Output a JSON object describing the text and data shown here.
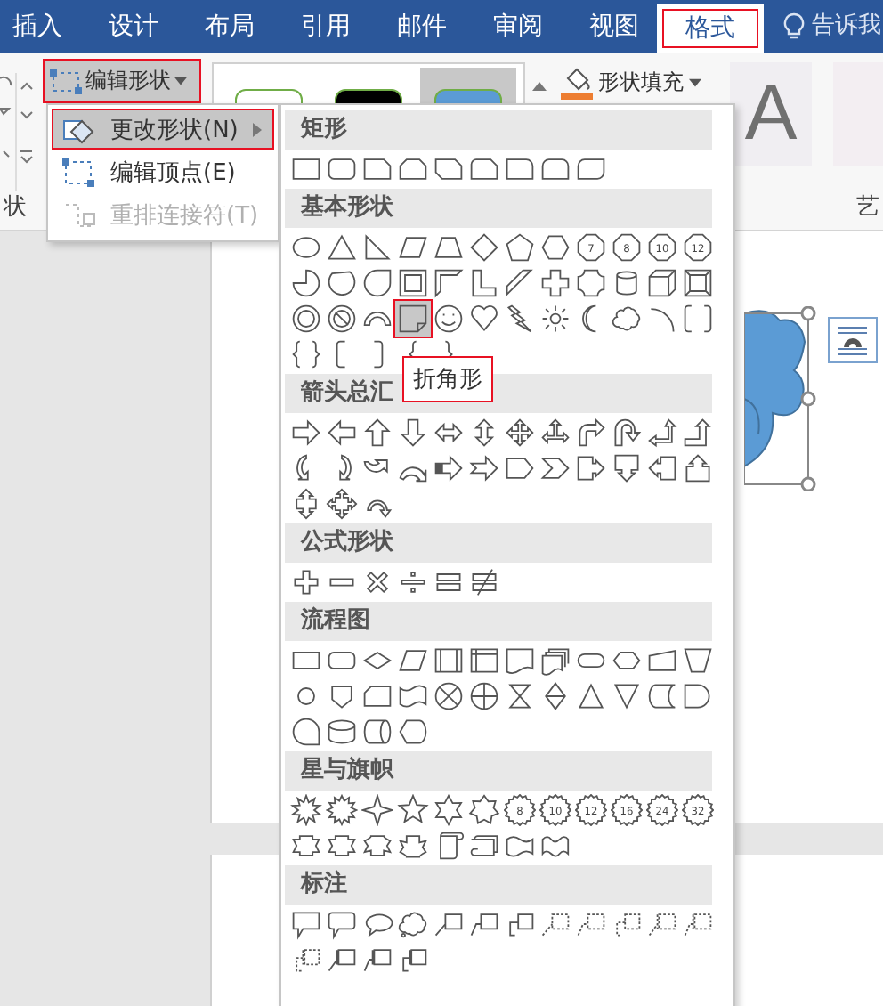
{
  "tabs": [
    {
      "label": "插入",
      "selected": false
    },
    {
      "label": "设计",
      "selected": false
    },
    {
      "label": "布局",
      "selected": false
    },
    {
      "label": "引用",
      "selected": false
    },
    {
      "label": "邮件",
      "selected": false
    },
    {
      "label": "审阅",
      "selected": false
    },
    {
      "label": "视图",
      "selected": false
    },
    {
      "label": "格式",
      "selected": true
    }
  ],
  "tell_me": "告诉我",
  "ribbon": {
    "edit_shape_button": {
      "label": "编辑形状",
      "highlighted": true
    },
    "style_swatches": [
      {
        "color": "#ffffff",
        "selected": false
      },
      {
        "color": "#000000",
        "selected": false
      },
      {
        "color": "#5b9bd5",
        "selected": true
      }
    ],
    "shape_fill": "形状填充",
    "wordart": [
      "A"
    ],
    "group_labels": [
      "状",
      "艺"
    ]
  },
  "submenu": [
    {
      "label": "更改形状(N)",
      "selected": true,
      "disabled": false,
      "has_submenu": true
    },
    {
      "label": "编辑顶点(E)",
      "selected": false,
      "disabled": false,
      "has_submenu": false
    },
    {
      "label": "重排连接符(T)",
      "selected": false,
      "disabled": true,
      "has_submenu": false
    }
  ],
  "gallery": [
    {
      "title": "矩形",
      "shapes": [
        {
          "kind": "rectangle",
          "selected": false
        },
        {
          "kind": "rounded-rectangle",
          "selected": false
        },
        {
          "kind": "snipped-corner-rectangle",
          "selected": false
        },
        {
          "kind": "snipped-same-side-rectangle",
          "selected": false
        },
        {
          "kind": "snipped-diagonal-rectangle",
          "selected": false
        },
        {
          "kind": "snipped-rounded-rectangle",
          "selected": false
        },
        {
          "kind": "round-corner-rectangle",
          "selected": false
        },
        {
          "kind": "round-same-side-rectangle",
          "selected": false
        },
        {
          "kind": "round-diagonal-rectangle",
          "selected": false
        }
      ]
    },
    {
      "title": "基本形状",
      "shapes": [
        {
          "kind": "oval",
          "selected": false
        },
        {
          "kind": "triangle",
          "selected": false
        },
        {
          "kind": "right-triangle",
          "selected": false
        },
        {
          "kind": "parallelogram",
          "selected": false
        },
        {
          "kind": "trapezoid",
          "selected": false
        },
        {
          "kind": "diamond",
          "selected": false
        },
        {
          "kind": "pentagon",
          "selected": false
        },
        {
          "kind": "hexagon",
          "selected": false
        },
        {
          "kind": "polygon-badge",
          "label": "7",
          "selected": false
        },
        {
          "kind": "polygon-badge",
          "label": "8",
          "selected": false
        },
        {
          "kind": "polygon-badge",
          "label": "10",
          "selected": false
        },
        {
          "kind": "polygon-badge",
          "label": "12",
          "selected": false
        },
        {
          "kind": "pie",
          "selected": false
        },
        {
          "kind": "chord",
          "selected": false
        },
        {
          "kind": "teardrop",
          "selected": false
        },
        {
          "kind": "frame",
          "selected": false
        },
        {
          "kind": "half-frame",
          "selected": false
        },
        {
          "kind": "l-shape",
          "selected": false
        },
        {
          "kind": "diagonal-stripe",
          "selected": false
        },
        {
          "kind": "cross",
          "selected": false
        },
        {
          "kind": "plaque",
          "selected": false
        },
        {
          "kind": "can",
          "selected": false
        },
        {
          "kind": "cube",
          "selected": false
        },
        {
          "kind": "bevel",
          "selected": false
        },
        {
          "kind": "donut",
          "selected": false
        },
        {
          "kind": "no-symbol",
          "selected": false
        },
        {
          "kind": "block-arc",
          "selected": false
        },
        {
          "kind": "folded-corner",
          "selected": true
        },
        {
          "kind": "smiley",
          "selected": false
        },
        {
          "kind": "heart",
          "selected": false
        },
        {
          "kind": "lightning",
          "selected": false
        },
        {
          "kind": "sun",
          "selected": false
        },
        {
          "kind": "moon",
          "selected": false
        },
        {
          "kind": "cloud",
          "selected": false
        },
        {
          "kind": "arc",
          "selected": false
        },
        {
          "kind": "bracket-pair",
          "selected": false
        },
        {
          "kind": "brace-pair",
          "selected": false
        },
        {
          "kind": "left-bracket",
          "selected": false
        },
        {
          "kind": "right-bracket",
          "selected": false
        },
        {
          "kind": "left-brace",
          "selected": false
        },
        {
          "kind": "right-brace",
          "selected": false
        }
      ]
    },
    {
      "title": "箭头总汇",
      "shapes": [
        {
          "kind": "right-arrow",
          "selected": false
        },
        {
          "kind": "left-arrow",
          "selected": false
        },
        {
          "kind": "up-arrow",
          "selected": false
        },
        {
          "kind": "down-arrow",
          "selected": false
        },
        {
          "kind": "left-right-arrow",
          "selected": false
        },
        {
          "kind": "up-down-arrow",
          "selected": false
        },
        {
          "kind": "quad-arrow",
          "selected": false
        },
        {
          "kind": "left-right-up-arrow",
          "selected": false
        },
        {
          "kind": "bent-arrow",
          "selected": false
        },
        {
          "kind": "u-turn-arrow",
          "selected": false
        },
        {
          "kind": "left-up-arrow",
          "selected": false
        },
        {
          "kind": "bent-up-arrow",
          "selected": false
        },
        {
          "kind": "curved-right-arrow",
          "selected": false
        },
        {
          "kind": "curved-left-arrow",
          "selected": false
        },
        {
          "kind": "curved-up-arrow",
          "selected": false
        },
        {
          "kind": "curved-down-arrow",
          "selected": false
        },
        {
          "kind": "striped-right-arrow",
          "selected": false
        },
        {
          "kind": "notched-right-arrow",
          "selected": false
        },
        {
          "kind": "pentagon-arrow",
          "selected": false
        },
        {
          "kind": "chevron",
          "selected": false
        },
        {
          "kind": "right-arrow-callout",
          "selected": false
        },
        {
          "kind": "down-arrow-callout",
          "selected": false
        },
        {
          "kind": "left-arrow-callout",
          "selected": false
        },
        {
          "kind": "up-arrow-callout",
          "selected": false
        },
        {
          "kind": "up-down-arrow-callout",
          "selected": false
        },
        {
          "kind": "quad-arrow-callout",
          "selected": false
        },
        {
          "kind": "circular-arrow",
          "selected": false
        }
      ]
    },
    {
      "title": "公式形状",
      "shapes": [
        {
          "kind": "plus",
          "selected": false
        },
        {
          "kind": "minus",
          "selected": false
        },
        {
          "kind": "multiply",
          "selected": false
        },
        {
          "kind": "divide",
          "selected": false
        },
        {
          "kind": "equal",
          "selected": false
        },
        {
          "kind": "not-equal",
          "selected": false
        }
      ]
    },
    {
      "title": "流程图",
      "shapes": [
        {
          "kind": "process",
          "selected": false
        },
        {
          "kind": "alternate-process",
          "selected": false
        },
        {
          "kind": "decision",
          "selected": false
        },
        {
          "kind": "data",
          "selected": false
        },
        {
          "kind": "predefined-process",
          "selected": false
        },
        {
          "kind": "internal-storage",
          "selected": false
        },
        {
          "kind": "document",
          "selected": false
        },
        {
          "kind": "multidocument",
          "selected": false
        },
        {
          "kind": "terminator",
          "selected": false
        },
        {
          "kind": "preparation",
          "selected": false
        },
        {
          "kind": "manual-input",
          "selected": false
        },
        {
          "kind": "manual-operation",
          "selected": false
        },
        {
          "kind": "connector",
          "selected": false
        },
        {
          "kind": "off-page-connector",
          "selected": false
        },
        {
          "kind": "card",
          "selected": false
        },
        {
          "kind": "punched-tape",
          "selected": false
        },
        {
          "kind": "summing-junction",
          "selected": false
        },
        {
          "kind": "or-symbol",
          "selected": false
        },
        {
          "kind": "collate",
          "selected": false
        },
        {
          "kind": "sort",
          "selected": false
        },
        {
          "kind": "extract",
          "selected": false
        },
        {
          "kind": "merge",
          "selected": false
        },
        {
          "kind": "stored-data",
          "selected": false
        },
        {
          "kind": "delay",
          "selected": false
        },
        {
          "kind": "sequential-access",
          "selected": false
        },
        {
          "kind": "magnetic-disk",
          "selected": false
        },
        {
          "kind": "direct-access-storage",
          "selected": false
        },
        {
          "kind": "display",
          "selected": false
        }
      ]
    },
    {
      "title": "星与旗帜",
      "shapes": [
        {
          "kind": "explosion",
          "selected": false
        },
        {
          "kind": "jagged-explosion",
          "selected": false
        },
        {
          "kind": "four-point-star",
          "selected": false
        },
        {
          "kind": "five-point-star",
          "selected": false
        },
        {
          "kind": "six-point-star",
          "selected": false
        },
        {
          "kind": "seven-point-star",
          "selected": false
        },
        {
          "kind": "seal",
          "label": "8",
          "selected": false
        },
        {
          "kind": "seal",
          "label": "10",
          "selected": false
        },
        {
          "kind": "seal",
          "label": "12",
          "selected": false
        },
        {
          "kind": "seal",
          "label": "16",
          "selected": false
        },
        {
          "kind": "seal",
          "label": "24",
          "selected": false
        },
        {
          "kind": "seal",
          "label": "32",
          "selected": false
        },
        {
          "kind": "ribbon-down",
          "selected": false
        },
        {
          "kind": "ribbon-up",
          "selected": false
        },
        {
          "kind": "curved-ribbon-down",
          "selected": false
        },
        {
          "kind": "curved-ribbon-up",
          "selected": false
        },
        {
          "kind": "vertical-scroll",
          "selected": false
        },
        {
          "kind": "horizontal-scroll",
          "selected": false
        },
        {
          "kind": "wave",
          "selected": false
        },
        {
          "kind": "double-wave",
          "selected": false
        }
      ]
    },
    {
      "title": "标注",
      "shapes": [
        {
          "kind": "rectangular-callout",
          "selected": false
        },
        {
          "kind": "rounded-callout",
          "selected": false
        },
        {
          "kind": "oval-callout",
          "selected": false
        },
        {
          "kind": "cloud-callout",
          "selected": false
        },
        {
          "kind": "line-callout",
          "selected": false
        },
        {
          "kind": "angled-line-callout",
          "selected": false
        },
        {
          "kind": "elbow-line-callout",
          "selected": false
        },
        {
          "kind": "dashed-line-callout",
          "selected": false
        },
        {
          "kind": "dashed-angled-callout",
          "selected": false
        },
        {
          "kind": "dashed-elbow-callout",
          "selected": false
        },
        {
          "kind": "dashed-accent-callout",
          "selected": false
        },
        {
          "kind": "dashed-angled-accent-callout",
          "selected": false
        },
        {
          "kind": "dashed-elbow-accent-callout",
          "selected": false
        },
        {
          "kind": "accent-line-callout",
          "selected": false
        },
        {
          "kind": "accent-angled-callout",
          "selected": false
        },
        {
          "kind": "accent-elbow-callout",
          "selected": false
        }
      ]
    }
  ],
  "tooltip": {
    "text": "折角形",
    "highlighted": true
  }
}
